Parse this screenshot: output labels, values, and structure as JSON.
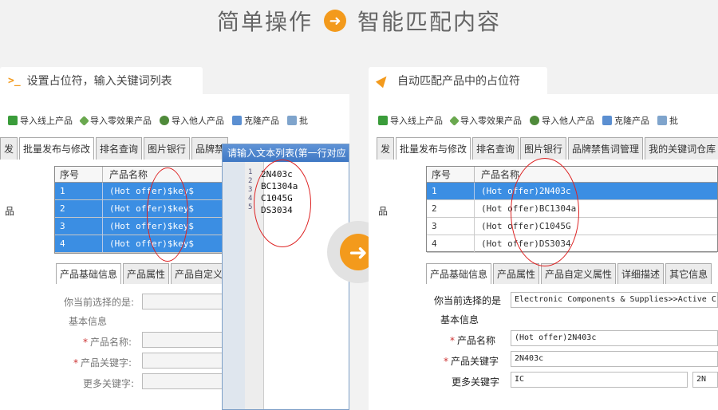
{
  "headline": {
    "left": "简单操作",
    "right": "智能匹配内容"
  },
  "colors": {
    "accent": "#f39a1c",
    "selection": "#3b8ee3",
    "circle": "#dd2222"
  },
  "steps": [
    {
      "icon": "prompt-icon",
      "glyph": ">_",
      "label": "设置占位符，输入关键词列表"
    },
    {
      "icon": "rocket-icon",
      "label": "自动匹配产品中的占位符"
    }
  ],
  "toolbar": {
    "import_online": "导入线上产品",
    "import_zero": "导入零效果产品",
    "import_others": "导入他人产品",
    "clone": "克隆产品",
    "batch": "批"
  },
  "left": {
    "tab_stub": "发",
    "tabs": [
      "批量发布与修改",
      "排名查询",
      "图片银行",
      "品牌禁"
    ],
    "side_char": "品",
    "grid": {
      "col_no": "序号",
      "col_name": "产品名称",
      "rows": [
        {
          "no": "1",
          "name": "(Hot offer)$key$"
        },
        {
          "no": "2",
          "name": "(Hot offer)$key$"
        },
        {
          "no": "3",
          "name": "(Hot offer)$key$"
        },
        {
          "no": "4",
          "name": "(Hot offer)$key$"
        }
      ]
    },
    "sub_tabs": [
      "产品基础信息",
      "产品属性",
      "产品自定义"
    ],
    "form": {
      "selected_label": "你当前选择的是:",
      "group_label": "基本信息",
      "name_label": "产品名称:",
      "keyword_label": "产品关键字:",
      "more_keyword_label": "更多关键字:"
    },
    "popup": {
      "title": "请输入文本列表(第一行对应",
      "line_numbers": [
        "1",
        "2",
        "3",
        "4",
        "5"
      ],
      "lines": [
        "2N403c",
        "BC1304a",
        "C1045G",
        "DS3034"
      ]
    }
  },
  "right": {
    "tab_stub": "发",
    "tabs": [
      "批量发布与修改",
      "排名查询",
      "图片银行",
      "品牌禁售词管理",
      "我的关键词仓库"
    ],
    "side_char": "品",
    "grid": {
      "col_no": "序号",
      "col_name": "产品名称",
      "rows": [
        {
          "no": "1",
          "name": "(Hot offer)2N403c"
        },
        {
          "no": "2",
          "name": "(Hot offer)BC1304a"
        },
        {
          "no": "3",
          "name": "(Hot offer)C1045G"
        },
        {
          "no": "4",
          "name": "(Hot offer)DS3034"
        }
      ]
    },
    "sub_tabs": [
      "产品基础信息",
      "产品属性",
      "产品自定义属性",
      "详细描述",
      "其它信息"
    ],
    "form": {
      "selected_label": "你当前选择的是",
      "selected_value": "Electronic Components & Supplies>>Active C",
      "group_label": "基本信息",
      "name_label": "产品名称",
      "name_value": "(Hot offer)2N403c",
      "keyword_label": "产品关键字",
      "keyword_value": "2N403c",
      "more_keyword_label": "更多关键字",
      "more_keyword_value": "IC",
      "more_keyword_value2": "2N"
    }
  }
}
